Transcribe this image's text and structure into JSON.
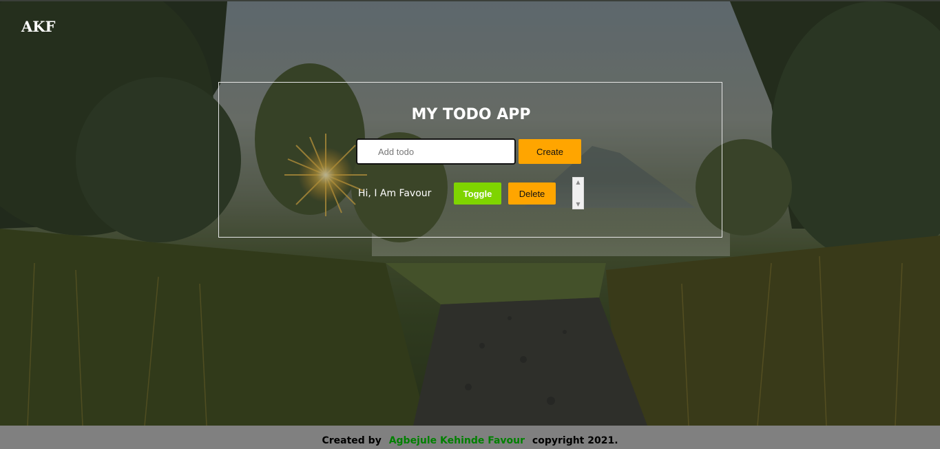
{
  "header": {
    "logo_text": "AKF"
  },
  "todo_app": {
    "title": "MY TODO APP",
    "input": {
      "placeholder": "Add todo",
      "value": ""
    },
    "create_label": "Create",
    "items": [
      {
        "text": "Hi, I Am Favour",
        "toggle_label": "Toggle",
        "delete_label": "Delete"
      }
    ]
  },
  "footer": {
    "prefix": "Created by",
    "author": "Agbejule Kehinde Favour",
    "suffix": "copyright 2021."
  },
  "colors": {
    "accent_orange": "#ffa500",
    "toggle_green": "#7fd400",
    "author_green": "#008000",
    "footer_bg": "#808080"
  }
}
